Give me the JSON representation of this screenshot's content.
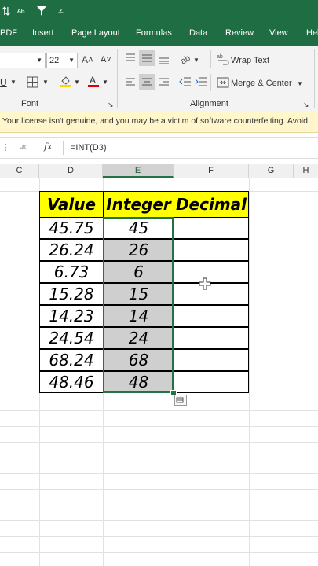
{
  "title_bar": {
    "filter_icon": "funnel-icon",
    "sort_icon": "sort-icon",
    "more_icon": "more-icon"
  },
  "tabs": [
    "PDF",
    "Insert",
    "Page Layout",
    "Formulas",
    "Data",
    "Review",
    "View",
    "Hel"
  ],
  "ribbon": {
    "font_size": "22",
    "grow_font": "A˄",
    "shrink_font": "A˅",
    "underline": "U",
    "font_group_label": "Font",
    "alignment_group_label": "Alignment",
    "wrap_text": "Wrap Text",
    "merge_center": "Merge & Center"
  },
  "license_message": "Your license isn't genuine, and you may be a victim of software counterfeiting. Avoid",
  "formula_bar": {
    "cancel": "✓",
    "fx": "fx",
    "formula": "=INT(D3)"
  },
  "columns": [
    "C",
    "D",
    "E",
    "F",
    "G",
    "H"
  ],
  "table": {
    "headers": [
      "Value",
      "Integer",
      "Decimal"
    ],
    "rows": [
      [
        "45.75",
        "45",
        ""
      ],
      [
        "26.24",
        "26",
        ""
      ],
      [
        "6.73",
        "6",
        ""
      ],
      [
        "15.28",
        "15",
        ""
      ],
      [
        "14.23",
        "14",
        ""
      ],
      [
        "24.54",
        "24",
        ""
      ],
      [
        "68.24",
        "68",
        ""
      ],
      [
        "48.46",
        "48",
        ""
      ]
    ]
  }
}
